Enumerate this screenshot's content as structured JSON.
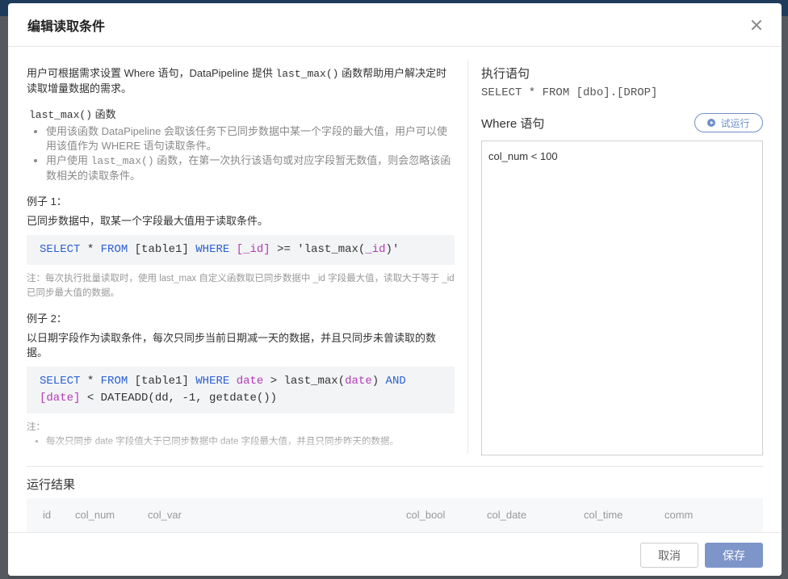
{
  "modal": {
    "title": "编辑读取条件"
  },
  "left": {
    "intro_a": "用户可根据需求设置 Where 语句，DataPipeline 提供 ",
    "intro_code": "last_max()",
    "intro_b": " 函数帮助用户解决定时读取增量数据的需求。",
    "func_code": "last_max()",
    "func_suffix": " 函数",
    "bullet1": "使用该函数 DataPipeline 会取该任务下已同步数据中某一个字段的最大值，用户可以使用该值作为 WHERE 语句读取条件。",
    "bullet2_a": "用户使用 ",
    "bullet2_code": "last_max()",
    "bullet2_b": " 函数，在第一次执行该语句或对应字段暂无数值，则会忽略该函数相关的读取条件。",
    "example1_title": "例子 1：",
    "example1_desc": "已同步数据中，取某一个字段最大值用于读取条件。",
    "example1_code": {
      "t1": "SELECT",
      "t2": " * ",
      "t3": "FROM",
      "t4": " [table1] ",
      "t5": "WHERE",
      "t6": " ",
      "t7": "[_id]",
      "t8": " >= 'last_max(",
      "t9": "_id",
      "t10": ")'"
    },
    "example1_note": "注：每次执行批量读取时，使用 last_max 自定义函数取已同步数据中 _id 字段最大值，读取大于等于 _id 已同步最大值的数据。",
    "example2_title": "例子 2：",
    "example2_desc": "以日期字段作为读取条件，每次只同步当前日期减一天的数据，并且只同步未曾读取的数据。",
    "example2_code": {
      "l1_t1": "SELECT",
      "l1_t2": " * ",
      "l1_t3": "FROM",
      "l1_t4": " [table1] ",
      "l1_t5": "WHERE",
      "l1_t6": " ",
      "l1_t7": "date",
      "l1_t8": " > last_max(",
      "l1_t9": "date",
      "l1_t10": ") ",
      "l1_t11": "AND",
      "l2_t1": "[date]",
      "l2_t2": " < DATEADD(dd, -1, getdate())"
    },
    "example2_note_title": "注：",
    "example2_note_bullet": "每次只同步 date 字段值大于已同步数据中 date 字段最大值，并且只同步昨天的数据。"
  },
  "right": {
    "exec_label": "执行语句",
    "exec_sql": "SELECT * FROM [dbo].[DROP]",
    "where_label": "Where 语句",
    "trial_label": "试运行",
    "where_value": "col_num < 100"
  },
  "result": {
    "title": "运行结果",
    "columns": [
      "id",
      "col_num",
      "col_var",
      "col_bool",
      "col_date",
      "col_time",
      "comm"
    ]
  },
  "footer": {
    "cancel_label": "取消",
    "save_label": "保存"
  },
  "colors": {
    "keyword": "#2a5fd1",
    "identifier": "#b23bb5",
    "primary": "#7d95c9"
  }
}
